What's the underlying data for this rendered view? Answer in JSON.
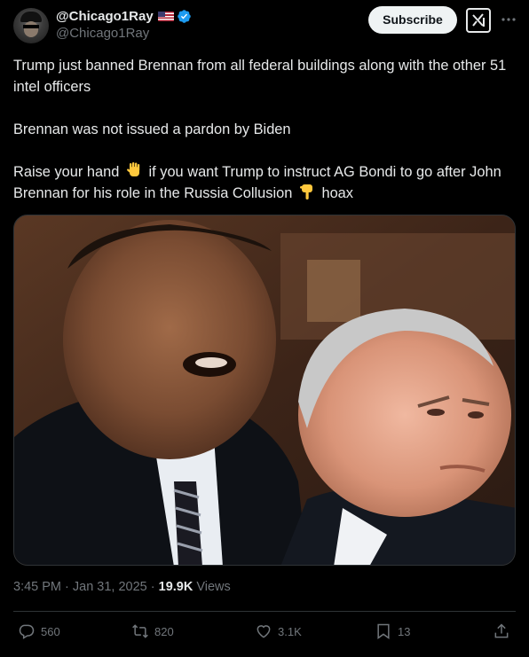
{
  "author": {
    "display_name": "@Chicago1Ray",
    "handle": "@Chicago1Ray",
    "verified": true,
    "flag_icon": "us-flag-icon"
  },
  "header": {
    "subscribe_label": "Subscribe",
    "grok_icon": "grok-icon",
    "more_icon": "more-icon"
  },
  "tweet": {
    "para1": "Trump just banned Brennan from all federal buildings along with the other 51 intel officers",
    "para2": "Brennan was not issued a pardon by Biden",
    "para3_part1": "Raise your hand",
    "para3_part2": "if you want Trump to instruct AG Bondi to go after John Brennan for his role in the Russia Collusion",
    "para3_part3": "hoax",
    "emoji1": "raised-hand-emoji",
    "emoji2": "backhand-index-pointing-down-emoji"
  },
  "media": {
    "kind": "photo of two men in suits"
  },
  "meta": {
    "time": "3:45 PM · Jan 31, 2025 · ",
    "views_count": "19.9K",
    "views_label": " Views"
  },
  "actions": {
    "replies": "560",
    "reposts": "820",
    "likes": "3.1K",
    "bookmarks": "13"
  },
  "colors": {
    "background": "#000000",
    "text": "#e7e9ea",
    "muted": "#71767b",
    "verified_blue": "#1d9bf0"
  }
}
